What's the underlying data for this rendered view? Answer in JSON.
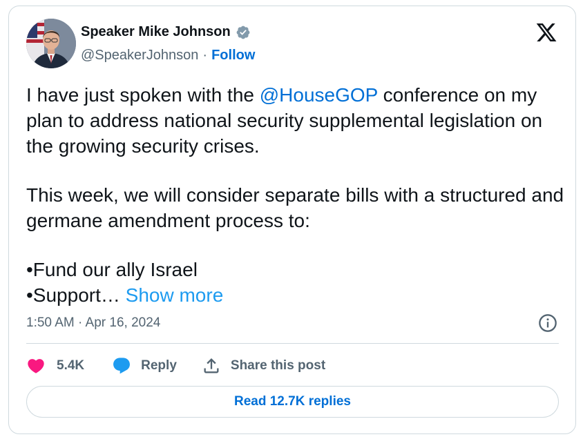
{
  "author": {
    "display_name": "Speaker Mike Johnson",
    "handle": "@SpeakerJohnson",
    "separator": "·",
    "follow_label": "Follow",
    "verified_color": "#829aab"
  },
  "tweet": {
    "line1_before": "I have just spoken with the ",
    "mention": "@HouseGOP",
    "line1_after": " conference on my plan to address national security supplemental legislation on the growing security crises.",
    "paragraph2": "This week, we will consider separate bills with a structured and germane amendment process to:",
    "bullet1": "•Fund our ally Israel",
    "bullet2": "•Support…",
    "show_more": "Show more"
  },
  "timestamp": "1:50 AM · Apr 16, 2024",
  "actions": {
    "like_count": "5.4K",
    "reply_label": "Reply",
    "share_label": "Share this post"
  },
  "read_replies_label": "Read 12.7K replies",
  "colors": {
    "like": "#f91880",
    "reply": "#1d9bf0",
    "link": "#006fd6",
    "muted": "#536471",
    "border": "#cfd9de"
  },
  "icons": [
    "verified-badge-icon",
    "x-logo-icon",
    "info-icon",
    "heart-icon",
    "reply-bubble-icon",
    "share-icon"
  ]
}
